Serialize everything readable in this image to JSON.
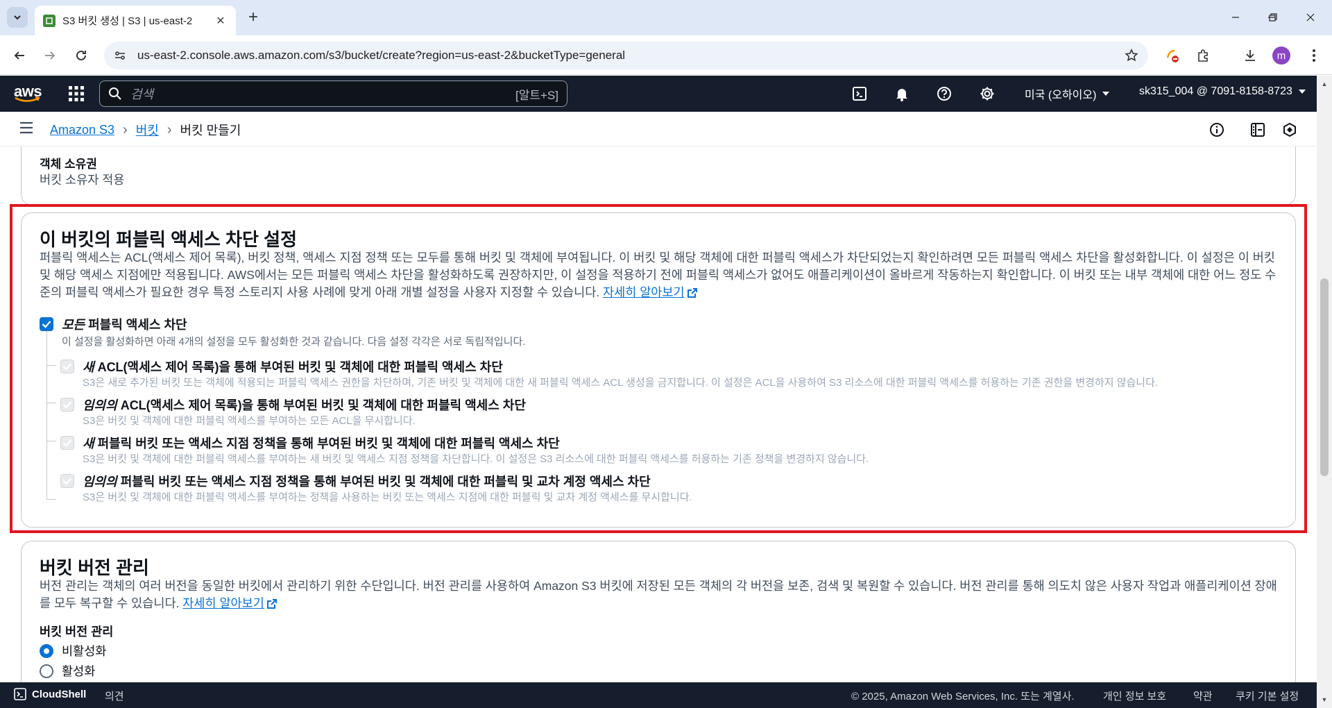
{
  "browser": {
    "tab_title": "S3 버킷 생성 | S3 | us-east-2",
    "url": "us-east-2.console.aws.amazon.com/s3/bucket/create?region=us-east-2&bucketType=general",
    "profile_initial": "m"
  },
  "aws_nav": {
    "logo": "aws",
    "search_placeholder": "검색",
    "search_shortcut": "[알트+S]",
    "region": "미국 (오하이오)",
    "account": "sk315_004 @ 7091-8158-8723"
  },
  "breadcrumbs": {
    "items": [
      "Amazon S3",
      "버킷"
    ],
    "current": "버킷 만들기"
  },
  "object_ownership": {
    "label": "객체 소유권",
    "value": "버킷 소유자 적용"
  },
  "public_access": {
    "title": "이 버킷의 퍼블릭 액세스 차단 설정",
    "description": "퍼블릭 액세스는 ACL(액세스 제어 목록), 버킷 정책, 액세스 지점 정책 또는 모두를 통해 버킷 및 객체에 부여됩니다. 이 버킷 및 해당 객체에 대한 퍼블릭 액세스가 차단되었는지 확인하려면 모든 퍼블릭 액세스 차단을 활성화합니다. 이 설정은 이 버킷 및 해당 액세스 지점에만 적용됩니다. AWS에서는 모든 퍼블릭 액세스 차단을 활성화하도록 권장하지만, 이 설정을 적용하기 전에 퍼블릭 액세스가 없어도 애플리케이션이 올바르게 작동하는지 확인합니다. 이 버킷 또는 내부 객체에 대한 어느 정도 수준의 퍼블릭 액세스가 필요한 경우 특정 스토리지 사용 사례에 맞게 아래 개별 설정을 사용자 지정할 수 있습니다.",
    "learn_more": "자세히 알아보기",
    "block_all": {
      "label_em": "모든",
      "label_rest": " 퍼블릭 액세스 차단",
      "sub": "이 설정을 활성화하면 아래 4개의 설정을 모두 활성화한 것과 같습니다. 다음 설정 각각은 서로 독립적입니다.",
      "checked": true
    },
    "options": [
      {
        "label_em": "새",
        "label_rest": " ACL(액세스 제어 목록)을 통해 부여된 버킷 및 객체에 대한 퍼블릭 액세스 차단",
        "sub": "S3은 새로 추가된 버킷 또는 객체에 적용되는 퍼블릭 액세스 권한을 차단하며, 기존 버킷 및 객체에 대한 새 퍼블릭 액세스 ACL 생성을 금지합니다. 이 설정은 ACL을 사용하여 S3 리소스에 대한 퍼블릭 액세스를 허용하는 기존 권한을 변경하지 않습니다."
      },
      {
        "label_em": "임의의",
        "label_rest": " ACL(액세스 제어 목록)을 통해 부여된 버킷 및 객체에 대한 퍼블릭 액세스 차단",
        "sub": "S3은 버킷 및 객체에 대한 퍼블릭 액세스를 부여하는 모든 ACL을 무시합니다."
      },
      {
        "label_em": "새",
        "label_rest": " 퍼블릭 버킷 또는 액세스 지점 정책을 통해 부여된 버킷 및 객체에 대한 퍼블릭 액세스 차단",
        "sub": "S3은 버킷 및 객체에 대한 퍼블릭 액세스를 부여하는 새 버킷 및 액세스 지점 정책을 차단합니다. 이 설정은 S3 리소스에 대한 퍼블릭 액세스를 허용하는 기존 정책을 변경하지 않습니다."
      },
      {
        "label_em": "임의의",
        "label_rest": " 퍼블릭 버킷 또는 액세스 지점 정책을 통해 부여된 버킷 및 객체에 대한 퍼블릭 및 교차 계정 액세스 차단",
        "sub": "S3은 버킷 및 객체에 대한 퍼블릭 액세스를 부여하는 정책을 사용하는 버킷 또는 액세스 지점에 대한 퍼블릭 및 교차 계정 액세스를 무시합니다."
      }
    ]
  },
  "versioning": {
    "title": "버킷 버전 관리",
    "description": "버전 관리는 객체의 여러 버전을 동일한 버킷에서 관리하기 위한 수단입니다. 버전 관리를 사용하여 Amazon S3 버킷에 저장된 모든 객체의 각 버전을 보존, 검색 및 복원할 수 있습니다. 버전 관리를 통해 의도치 않은 사용자 작업과 애플리케이션 장애를 모두 복구할 수 있습니다.",
    "learn_more": "자세히 알아보기",
    "field_label": "버킷 버전 관리",
    "options": [
      "비활성화",
      "활성화"
    ],
    "selected": "비활성화"
  },
  "footer": {
    "cloudshell": "CloudShell",
    "feedback": "의견",
    "copyright": "© 2025, Amazon Web Services, Inc. 또는 계열사.",
    "privacy": "개인 정보 보호",
    "terms": "약관",
    "cookies": "쿠키 기본 설정"
  },
  "colors": {
    "aws_nav_bg": "#161e2d",
    "link_blue": "#0972d3",
    "highlight_red": "#e0171e"
  }
}
